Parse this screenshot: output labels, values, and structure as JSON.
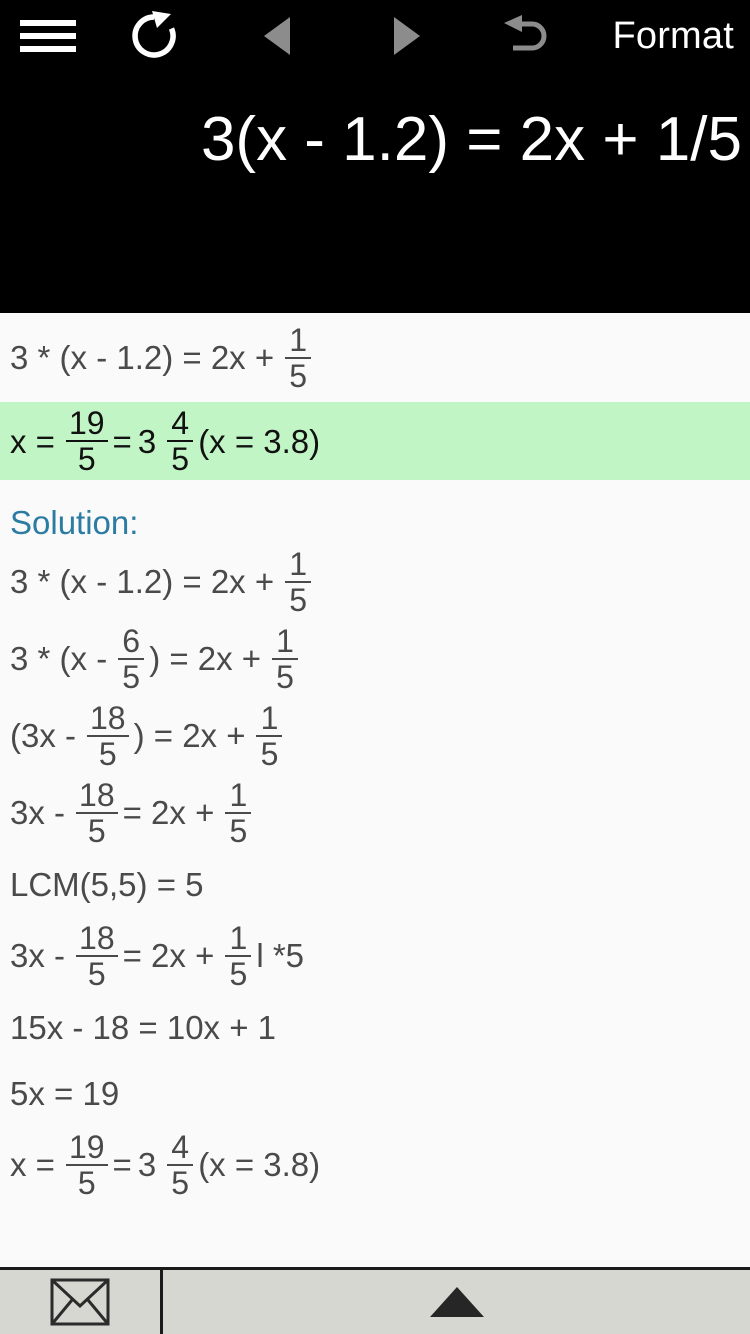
{
  "toolbar": {
    "menu_icon": "hamburger-menu-icon",
    "refresh_icon": "refresh-icon",
    "prev_icon": "previous-triangle-icon",
    "next_icon": "next-triangle-icon",
    "undo_icon": "undo-arrow-icon",
    "format_label": "Format"
  },
  "display": {
    "equation": "3(x - 1.2) = 2x + 1/5"
  },
  "result": {
    "echo": {
      "lhs": "3 * (x - 1.2) = 2x +",
      "frac_num": "1",
      "frac_den": "5"
    },
    "answer": {
      "prefix": "x =",
      "frac1_num": "19",
      "frac1_den": "5",
      "equals": "=",
      "whole": "3",
      "frac2_num": "4",
      "frac2_den": "5",
      "decimal": "(x = 3.8)"
    }
  },
  "solution": {
    "heading": "Solution:",
    "steps": [
      {
        "id": "step-1",
        "parts": [
          {
            "type": "text",
            "value": "3 * (x - 1.2) = 2x +"
          },
          {
            "type": "frac",
            "num": "1",
            "den": "5"
          }
        ]
      },
      {
        "id": "step-2",
        "parts": [
          {
            "type": "text",
            "value": "3 * (x -"
          },
          {
            "type": "frac",
            "num": "6",
            "den": "5"
          },
          {
            "type": "text",
            "value": ") = 2x +"
          },
          {
            "type": "frac",
            "num": "1",
            "den": "5"
          }
        ]
      },
      {
        "id": "step-3",
        "parts": [
          {
            "type": "text",
            "value": "(3x -"
          },
          {
            "type": "frac",
            "num": "18",
            "den": "5"
          },
          {
            "type": "text",
            "value": ") = 2x +"
          },
          {
            "type": "frac",
            "num": "1",
            "den": "5"
          }
        ]
      },
      {
        "id": "step-4",
        "parts": [
          {
            "type": "text",
            "value": "3x -"
          },
          {
            "type": "frac",
            "num": "18",
            "den": "5"
          },
          {
            "type": "text",
            "value": "= 2x +"
          },
          {
            "type": "frac",
            "num": "1",
            "den": "5"
          }
        ]
      },
      {
        "id": "step-5",
        "parts": [
          {
            "type": "text",
            "value": "LCM(5,5) = 5"
          }
        ]
      },
      {
        "id": "step-6",
        "parts": [
          {
            "type": "text",
            "value": "3x -"
          },
          {
            "type": "frac",
            "num": "18",
            "den": "5"
          },
          {
            "type": "text",
            "value": "= 2x +"
          },
          {
            "type": "frac",
            "num": "1",
            "den": "5"
          },
          {
            "type": "text",
            "value": "l *5"
          }
        ]
      },
      {
        "id": "step-7",
        "parts": [
          {
            "type": "text",
            "value": "15x - 18 = 10x + 1"
          }
        ]
      },
      {
        "id": "step-8",
        "parts": [
          {
            "type": "text",
            "value": "5x = 19"
          }
        ]
      },
      {
        "id": "step-9",
        "parts": [
          {
            "type": "text",
            "value": "x ="
          },
          {
            "type": "frac",
            "num": "19",
            "den": "5"
          },
          {
            "type": "text",
            "value": "="
          },
          {
            "type": "mixed",
            "whole": "3",
            "num": "4",
            "den": "5"
          },
          {
            "type": "text",
            "value": "(x = 3.8)"
          }
        ]
      }
    ]
  },
  "bottombar": {
    "mail_icon": "envelope-icon",
    "up_icon": "triangle-up-icon"
  },
  "colors": {
    "header_bg": "#000000",
    "sheet_bg": "#fafafa",
    "answer_highlight": "#c2f5c5",
    "solution_heading": "#2b7ba3",
    "math_text": "#4a4a4a",
    "bottom_bar": "#d6d7d0",
    "icon_grey": "#8c8c8c"
  }
}
